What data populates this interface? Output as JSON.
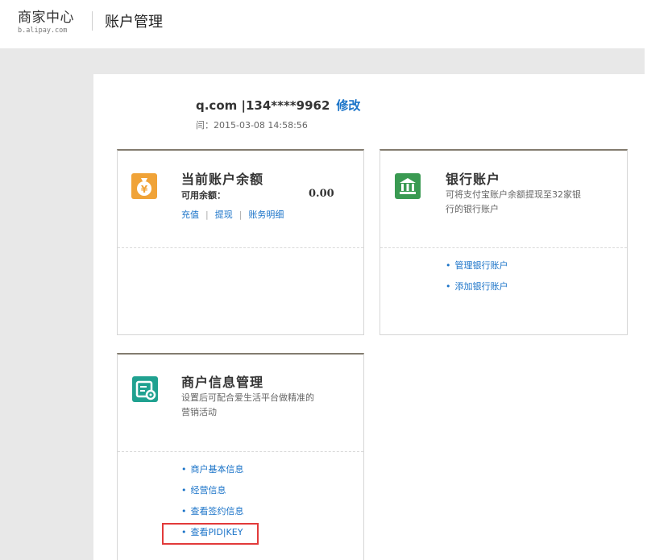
{
  "header": {
    "logo_main": "商家中心",
    "logo_sub": "b.alipay.com",
    "page_title": "账户管理"
  },
  "account": {
    "email_phone": "q.com |134****9962",
    "edit_label": "修改",
    "time_line": "闫：2015-03-08 14:58:56"
  },
  "balance_card": {
    "icon": "money-bag-icon",
    "title": "当前账户余额",
    "available_label": "可用余额：",
    "available_value": "0.00",
    "links": [
      "充值",
      "提现",
      "账务明细"
    ],
    "separator": "|"
  },
  "bank_card": {
    "icon": "bank-icon",
    "title": "银行账户",
    "desc_line1": "可将支付宝账户余额提现至32家银",
    "desc_line2": "行的银行账户",
    "links": [
      "管理银行账户",
      "添加银行账户"
    ]
  },
  "merchant_card": {
    "icon": "merchant-settings-icon",
    "title": "商户信息管理",
    "desc_line1": "设置后可配合爱生活平台做精准的",
    "desc_line2": "营销活动",
    "links": [
      "商户基本信息",
      "经营信息",
      "查看签约信息",
      "查看PID|KEY"
    ]
  },
  "colors": {
    "link": "#1a73c8",
    "card_top_border": "#837c6f",
    "balance_icon_bg": "#f0a338",
    "bank_icon_bg": "#3a9a52",
    "merchant_icon_bg": "#20a190",
    "highlight": "#e23a3a"
  }
}
